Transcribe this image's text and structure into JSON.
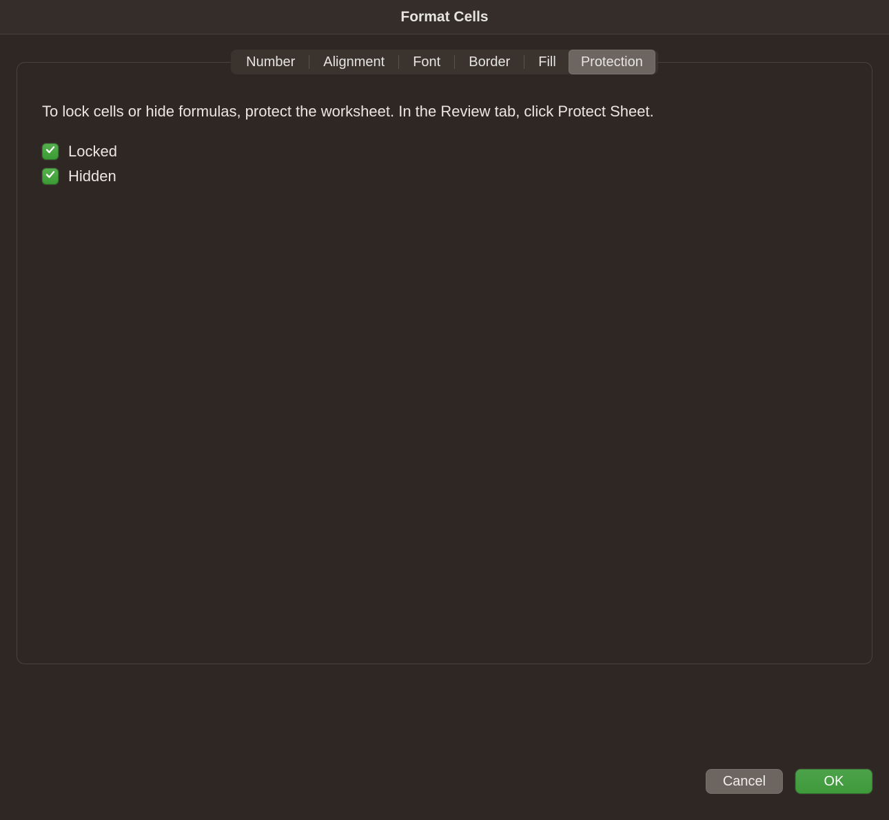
{
  "window": {
    "title": "Format Cells"
  },
  "tabs": {
    "items": [
      {
        "label": "Number"
      },
      {
        "label": "Alignment"
      },
      {
        "label": "Font"
      },
      {
        "label": "Border"
      },
      {
        "label": "Fill"
      },
      {
        "label": "Protection"
      }
    ],
    "active_index": 5
  },
  "protection": {
    "description": "To lock cells or hide formulas, protect the worksheet. In the Review tab, click Protect Sheet.",
    "locked_label": "Locked",
    "hidden_label": "Hidden",
    "locked_checked": true,
    "hidden_checked": true
  },
  "footer": {
    "cancel_label": "Cancel",
    "ok_label": "OK"
  }
}
